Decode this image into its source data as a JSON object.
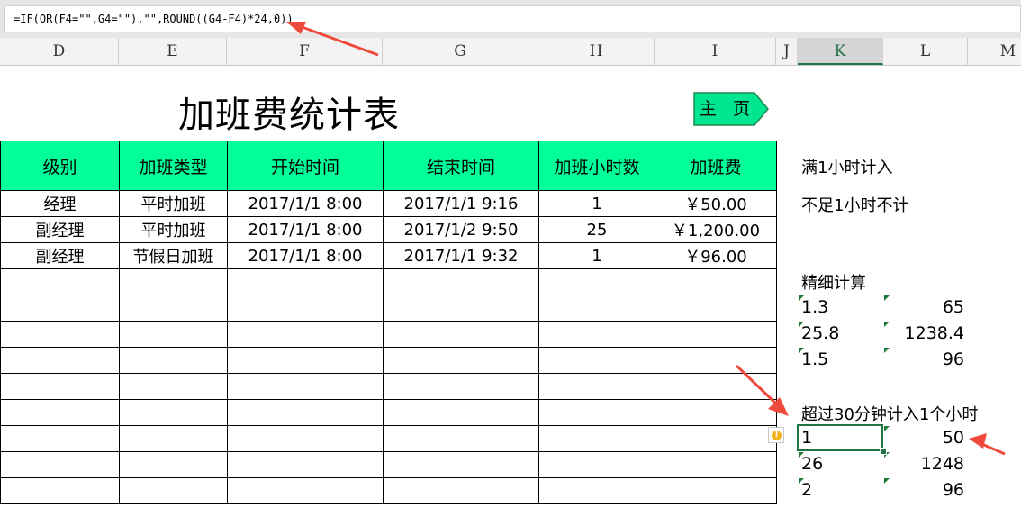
{
  "formula_bar": {
    "formula": "=IF(OR(F4=\"\",G4=\"\"),\"\",ROUND((G4-F4)*24,0))"
  },
  "column_headers": [
    "D",
    "E",
    "F",
    "G",
    "H",
    "I",
    "J",
    "K",
    "L",
    "M"
  ],
  "active_column": "K",
  "sheet": {
    "title": "加班费统计表",
    "home_button": "主 页",
    "table": {
      "headers": [
        "级别",
        "加班类型",
        "开始时间",
        "结束时间",
        "加班小时数",
        "加班费"
      ],
      "rows": [
        [
          "经理",
          "平时加班",
          "2017/1/1 8:00",
          "2017/1/1 9:16",
          "1",
          "￥50.00"
        ],
        [
          "副经理",
          "平时加班",
          "2017/1/1 8:00",
          "2017/1/2 9:50",
          "25",
          "￥1,200.00"
        ],
        [
          "副经理",
          "节假日加班",
          "2017/1/1 8:00",
          "2017/1/1 9:32",
          "1",
          "￥96.00"
        ]
      ]
    }
  },
  "side": {
    "note_full_hour": "满1小时计入",
    "note_under_hour": "不足1小时不计",
    "fine_label": "精细计算",
    "fine_rows": [
      [
        "1.3",
        "65"
      ],
      [
        "25.8",
        "1238.4"
      ],
      [
        "1.5",
        "96"
      ]
    ],
    "over30_label": "超过30分钟计入1个小时",
    "over30_rows": [
      [
        "1",
        "50"
      ],
      [
        "26",
        "1248"
      ],
      [
        "2",
        "96"
      ]
    ]
  },
  "colors": {
    "header_fill": "#00ff99",
    "home_fill": "#00e58f",
    "arrow": "#ef4b3c",
    "selection": "#217346"
  },
  "icons": {
    "warning": "exclamation-warning-icon"
  }
}
